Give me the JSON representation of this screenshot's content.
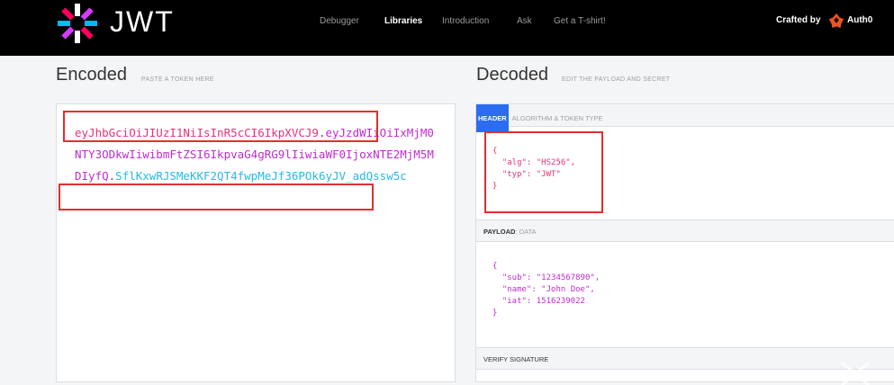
{
  "header": {
    "logo_word": "JWT",
    "nav": [
      "Debugger",
      "Libraries",
      "Introduction",
      "Ask",
      "Get a T-shirt!"
    ],
    "active_nav": "Libraries",
    "crafted_by": "Crafted by",
    "brand": "Auth0",
    "colors": {
      "bg": "#000000",
      "active": "#ffffff",
      "inactive": "#9a9a9a"
    }
  },
  "encoded": {
    "title": "Encoded",
    "subtitle": "PASTE A TOKEN HERE",
    "token": {
      "header_part": "eyJhbGciOiJIUzI1NiIsInR5cCI6IkpXVCJ9",
      "payload_part": "eyJzdWIiOiIxMjM0NTY3ODkwIiwibmFtZSI6IkpvaG4gRG9lIiwiaWF0IjoxNTE2MjM5MDIyfQ",
      "signature_part": "SflKxwRJSMeKKF2QT4fwpMeJf36POk6yJV_adQssw5c",
      "dot": "."
    },
    "colors": {
      "header": "#e6327a",
      "payload": "#c22bd0",
      "signature": "#28b8e6"
    }
  },
  "decoded": {
    "title": "Decoded",
    "subtitle": "EDIT THE PAYLOAD AND SECRET",
    "header_section": {
      "tag": "HEADER",
      "desc": "ALGORITHM & TOKEN TYPE"
    },
    "header_json": "{\n  \"alg\": \"HS256\",\n  \"typ\": \"JWT\"\n}",
    "payload_section": {
      "tag": "PAYLOAD",
      "desc": "DATA"
    },
    "payload_json": "{\n  \"sub\": \"1234567890\",\n  \"name\": \"John Doe\",\n  \"iat\": 1516239022\n}",
    "verify_section": {
      "label": "VERIFY SIGNATURE"
    }
  },
  "highlight_color": "#e02f2f"
}
